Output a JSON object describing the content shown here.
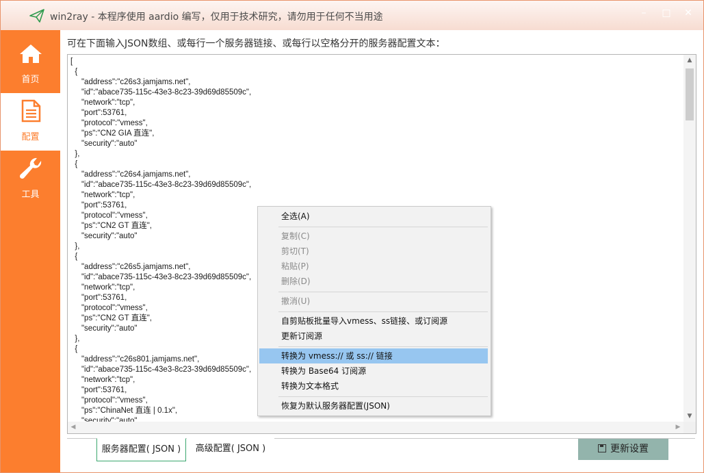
{
  "title_bar": {
    "title": "win2ray - 本程序使用 aardio 编写，仅用于技术研究，请勿用于任何不当用途",
    "min_glyph": "–",
    "max_glyph": "□",
    "close_glyph": "✕"
  },
  "sidebar": {
    "items": [
      {
        "label": "首页",
        "icon": "home-icon"
      },
      {
        "label": "配置",
        "icon": "document-icon",
        "active": true
      },
      {
        "label": "工具",
        "icon": "wrench-icon"
      }
    ]
  },
  "main": {
    "instruction": "可在下面输入JSON数组、或每行一个服务器链接、或每行以空格分开的服务器配置文本：",
    "editor_text": "[\n  {\n     \"address\":\"c26s3.jamjams.net\",\n     \"id\":\"abace735-115c-43e3-8c23-39d69d85509c\",\n     \"network\":\"tcp\",\n     \"port\":53761,\n     \"protocol\":\"vmess\",\n     \"ps\":\"CN2 GIA 直连\",\n     \"security\":\"auto\"\n  },\n  {\n     \"address\":\"c26s4.jamjams.net\",\n     \"id\":\"abace735-115c-43e3-8c23-39d69d85509c\",\n     \"network\":\"tcp\",\n     \"port\":53761,\n     \"protocol\":\"vmess\",\n     \"ps\":\"CN2 GT 直连\",\n     \"security\":\"auto\"\n  },\n  {\n     \"address\":\"c26s5.jamjams.net\",\n     \"id\":\"abace735-115c-43e3-8c23-39d69d85509c\",\n     \"network\":\"tcp\",\n     \"port\":53761,\n     \"protocol\":\"vmess\",\n     \"ps\":\"CN2 GT 直连\",\n     \"security\":\"auto\"\n  },\n  {\n     \"address\":\"c26s801.jamjams.net\",\n     \"id\":\"abace735-115c-43e3-8c23-39d69d85509c\",\n     \"network\":\"tcp\",\n     \"port\":53761,\n     \"protocol\":\"vmess\",\n     \"ps\":\"ChinaNet 直连 | 0.1x\",\n     \"security\":\"auto\""
  },
  "tabs": [
    {
      "label": "服务器配置( JSON )",
      "active": true
    },
    {
      "label": "高级配置( JSON )"
    }
  ],
  "update_button": {
    "label": "更新设置"
  },
  "context_menu": {
    "select_all": "全选(A)",
    "copy": "复制(C)",
    "cut": "剪切(T)",
    "paste": "粘贴(P)",
    "delete": "删除(D)",
    "undo": "撤消(U)",
    "import_clipboard": "自剪贴板批量导入vmess、ss链接、或订阅源",
    "update_subscription": "更新订阅源",
    "convert_links": "转换为 vmess:// 或 ss:// 链接",
    "convert_base64": "转换为 Base64 订阅源",
    "convert_text": "转换为文本格式",
    "restore_default": "恢复为默认服务器配置(JSON)"
  },
  "colors": {
    "accent": "#fc7e2e",
    "menu_highlight": "#97c6f0",
    "button": "#93b4ac",
    "tab_border": "#3aa66e"
  }
}
